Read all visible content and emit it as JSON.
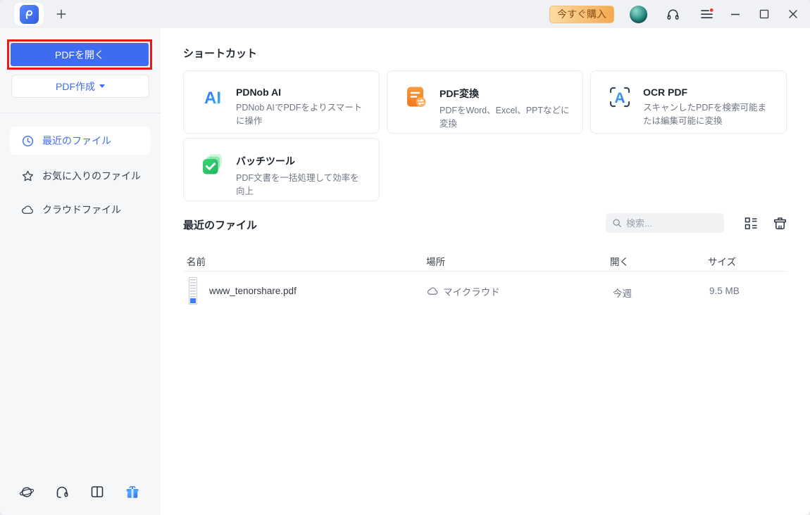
{
  "topbar": {
    "buy_label": "今すぐ購入",
    "tab_icon": "pdnob-app-logo",
    "icons": [
      "plus-icon",
      "user-avatar",
      "headset-icon",
      "menu-icon",
      "minimize-icon",
      "maximize-icon",
      "close-icon"
    ]
  },
  "sidebar": {
    "open_pdf_label": "PDFを開く",
    "create_pdf_label": "PDF作成",
    "items": [
      {
        "label": "最近のファイル",
        "icon": "clock-icon",
        "active": true
      },
      {
        "label": "お気に入りのファイル",
        "icon": "star-icon",
        "active": false
      },
      {
        "label": "クラウドファイル",
        "icon": "cloud-icon",
        "active": false
      }
    ],
    "footer_icons": [
      "language-globe-icon",
      "support-headset-icon",
      "user-guide-book-icon",
      "gift-icon"
    ]
  },
  "main": {
    "shortcuts_title": "ショートカット",
    "cards": [
      {
        "title": "PDNob AI",
        "desc": "PDNob AIでPDFをよりスマートに操作",
        "icon": "ai-icon",
        "icon_text": "AI"
      },
      {
        "title": "PDF変換",
        "desc": "PDFをWord、Excel、PPTなどに変換",
        "icon": "convert-icon"
      },
      {
        "title": "OCR PDF",
        "desc": "スキャンしたPDFを検索可能または編集可能に変換",
        "icon": "ocr-icon",
        "icon_text": "A"
      },
      {
        "title": "バッチツール",
        "desc": "PDF文書を一括処理して効率を向上",
        "icon": "batch-icon"
      }
    ],
    "recent_title": "最近のファイル",
    "search_placeholder": "検索...",
    "table": {
      "headers": [
        "名前",
        "場所",
        "開く",
        "サイズ"
      ],
      "rows": [
        {
          "name": "www_tenorshare.pdf",
          "location": "マイクラウド",
          "opened": "今週",
          "size": "9.5 MB"
        }
      ]
    }
  },
  "colors": {
    "accent_blue": "#3E6BF0",
    "annotation_red": "#E21B1B",
    "buy_gradient": [
      "#FCDCA4",
      "#F3A952"
    ],
    "buy_text": "#8A4D15",
    "convert_orange": "#F6861F",
    "batch_green": "#2FCB6F",
    "ocr_blue": "#2F7DF6",
    "sidebar_bg": "#F6F7F9",
    "topbar_bg": "#F0F1F4"
  }
}
